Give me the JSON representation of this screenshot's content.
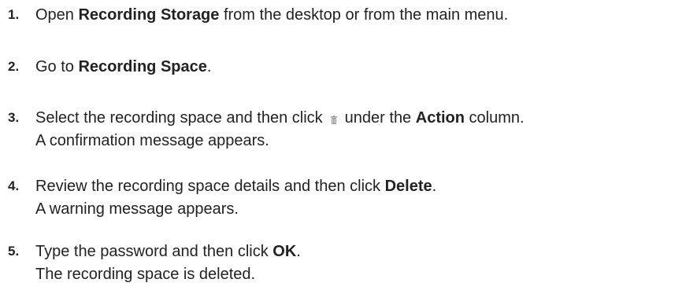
{
  "steps": [
    {
      "number": "1.",
      "parts": [
        "Open ",
        "Recording Storage",
        " from the desktop or from the main menu."
      ]
    },
    {
      "number": "2.",
      "parts": [
        "Go to ",
        "Recording Space",
        "."
      ]
    },
    {
      "number": "3.",
      "parts": [
        "Select the recording space and then click",
        "under the ",
        "Action",
        " column."
      ],
      "icon": "trash-icon",
      "result": "A confirmation message appears."
    },
    {
      "number": "4.",
      "parts": [
        "Review the recording space details and then click ",
        "Delete",
        "."
      ],
      "result": "A warning message appears."
    },
    {
      "number": "5.",
      "parts": [
        "Type the password and then click ",
        "OK",
        "."
      ],
      "result": "The recording space is deleted."
    }
  ],
  "colors": {
    "text": "#222222",
    "icon": "#9a9a9a"
  }
}
